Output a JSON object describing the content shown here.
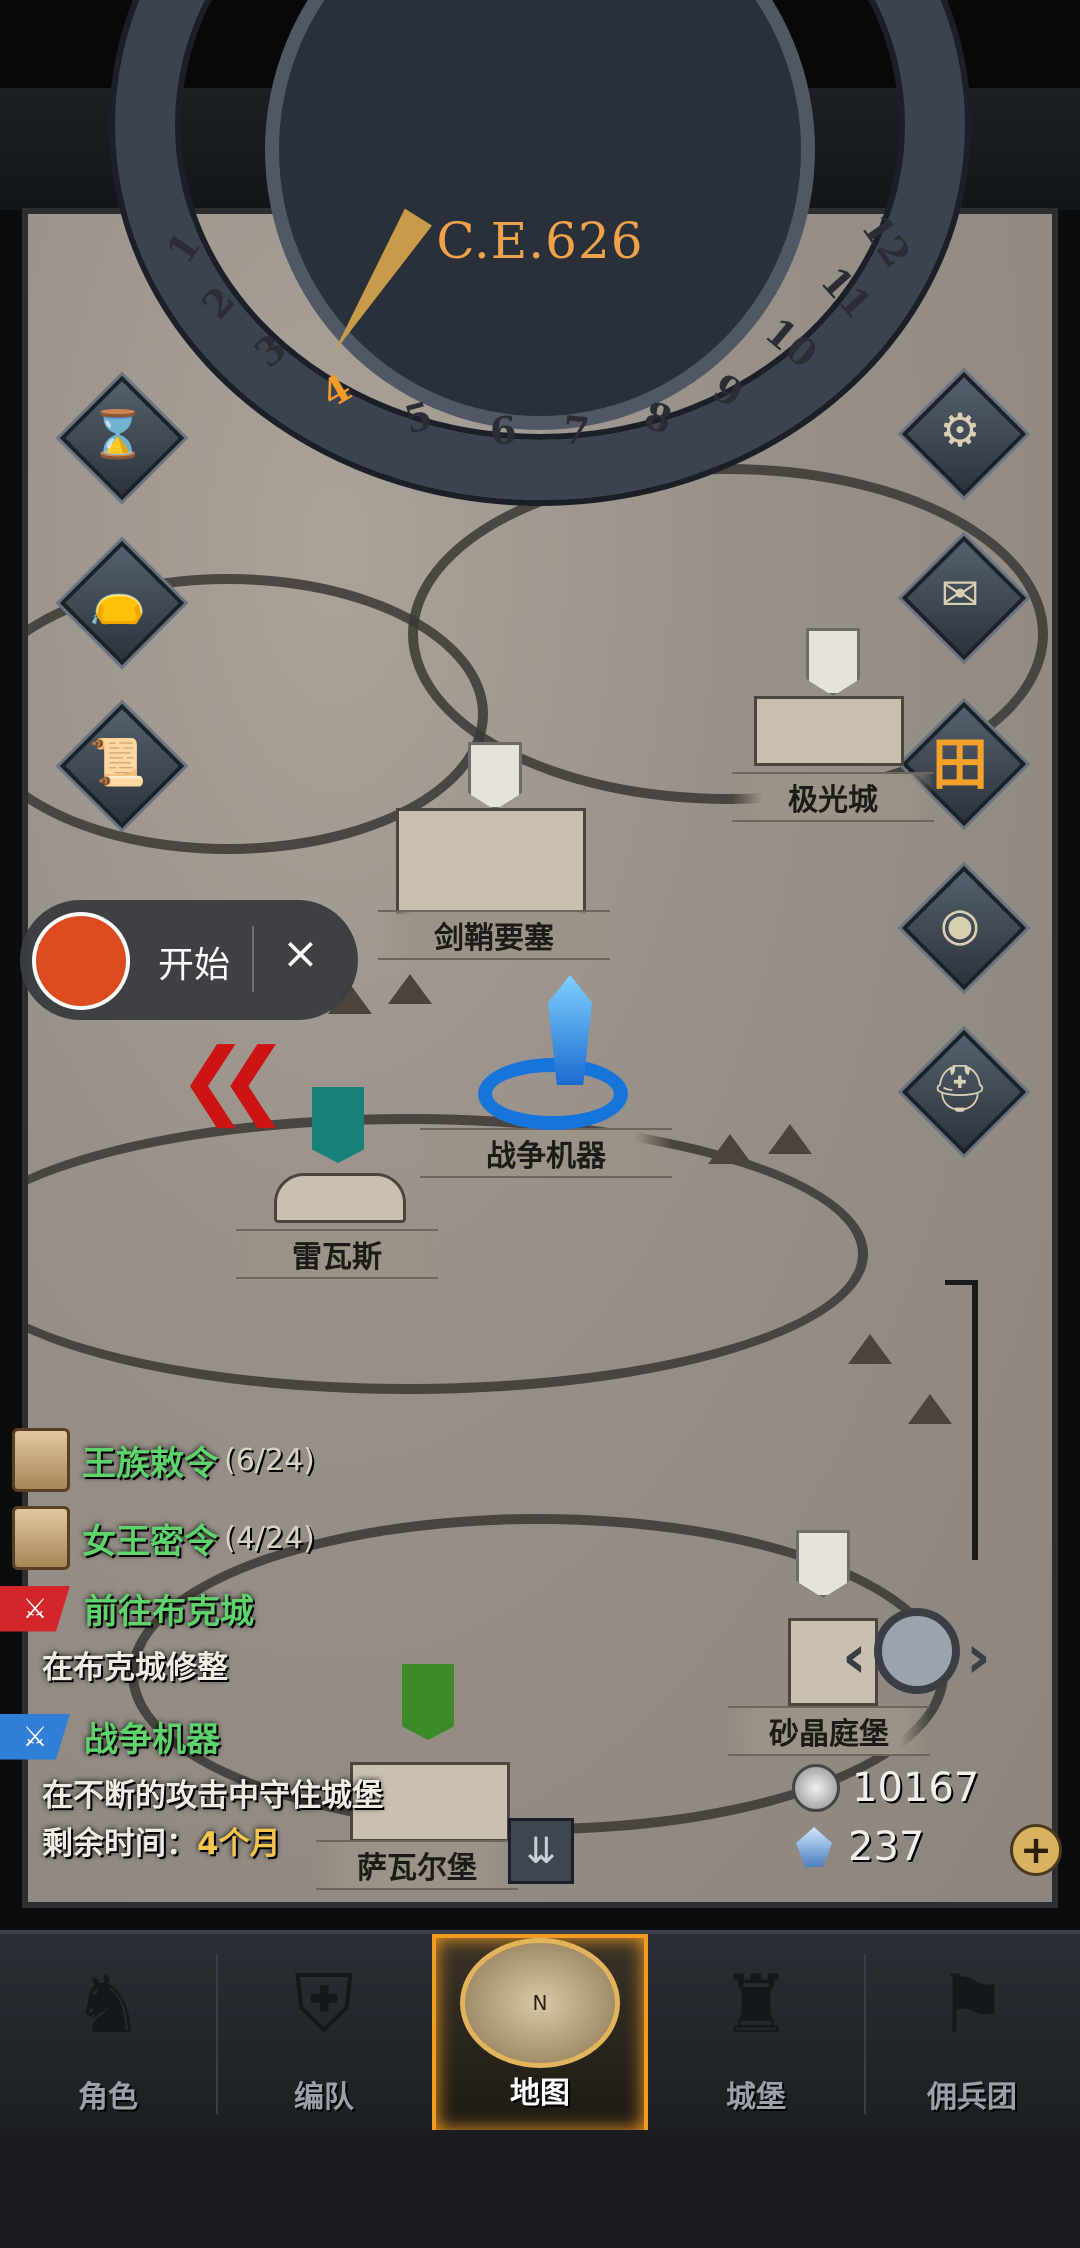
{
  "calendar": {
    "year": "C.E.626",
    "months": [
      "1",
      "2",
      "3",
      "4",
      "5",
      "6",
      "7",
      "8",
      "9",
      "10",
      "11",
      "12"
    ],
    "active_month": "4"
  },
  "side_buttons_left": [
    {
      "icon": "hourglass-icon",
      "glyph": "⌛"
    },
    {
      "icon": "money-bag-icon",
      "glyph": "👝"
    },
    {
      "icon": "scroll-icon",
      "glyph": "📜"
    }
  ],
  "side_buttons_right": [
    {
      "icon": "gear-icon",
      "glyph": "⚙"
    },
    {
      "icon": "mail-icon",
      "glyph": "✉"
    },
    {
      "icon": "grid-icon",
      "glyph": "田"
    },
    {
      "icon": "coin-stack-icon",
      "glyph": "◉"
    },
    {
      "icon": "helmet-icon",
      "glyph": "⛑"
    }
  ],
  "cities": {
    "aurora": "极光城",
    "sheath_fort": "剑鞘要塞",
    "war_machine": "战争机器",
    "levas": "雷瓦斯",
    "sandcrystal": "砂晶庭堡",
    "savar": "萨瓦尔堡"
  },
  "recorder": {
    "start_label": "开始",
    "close_label": "×"
  },
  "quests": [
    {
      "title": "王族敕令",
      "progress": "(6/24)"
    },
    {
      "title": "女王密令",
      "progress": "(4/24)"
    }
  ],
  "missions": [
    {
      "title": "前往布克城",
      "desc": "在布克城修整"
    },
    {
      "title": "战争机器",
      "desc": "在不断的攻击中守住城堡",
      "time_label": "剩余时间：",
      "time_value": "4个月"
    }
  ],
  "resources": {
    "silver": "10167",
    "crystal": "237"
  },
  "nav": {
    "tabs": [
      {
        "label": "角色",
        "icon": "knight-icon"
      },
      {
        "label": "编队",
        "icon": "helmet-squad-icon"
      },
      {
        "label": "地图",
        "icon": "compass-map-icon",
        "compass_letter": "N"
      },
      {
        "label": "城堡",
        "icon": "castle-icon"
      },
      {
        "label": "佣兵团",
        "icon": "mercenary-icon"
      }
    ],
    "active": "地图"
  }
}
